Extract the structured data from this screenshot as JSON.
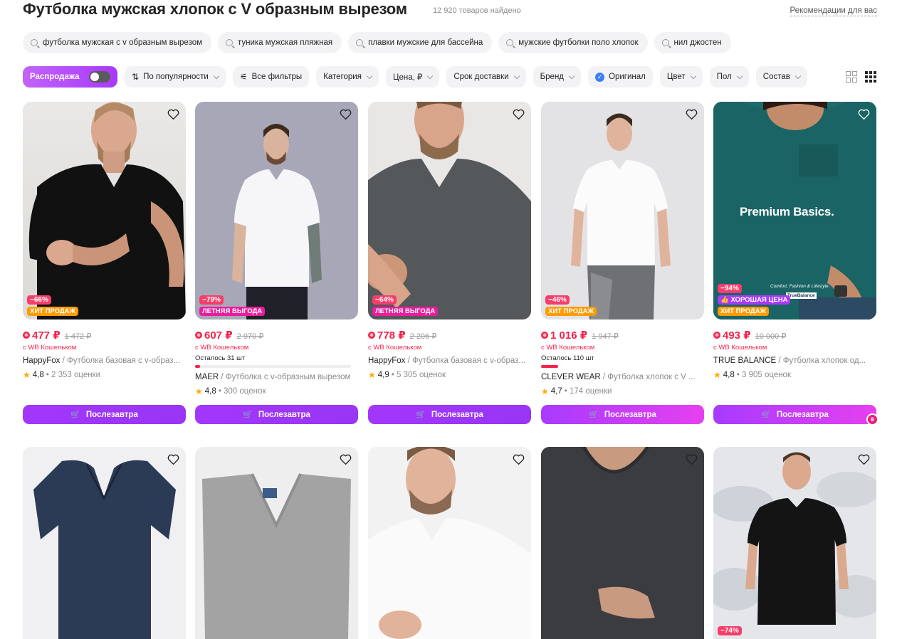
{
  "header": {
    "title": "Футболка мужская хлопок с V образным вырезом",
    "count": "12 920 товаров найдено",
    "recommendations": "Рекомендации для вас"
  },
  "chips": [
    "футболка мужская с v образным вырезом",
    "туника мужская пляжная",
    "плавки мужские для бассейна",
    "мужские футболки поло хлопок",
    "нил джостен"
  ],
  "filters": {
    "sale": "Распродажа",
    "sort": "По популярности",
    "all": "Все фильтры",
    "category": "Категория",
    "price": "Цена, ₽",
    "delivery": "Срок доставки",
    "brand": "Бренд",
    "original": "Оригинал",
    "color": "Цвет",
    "gender": "Пол",
    "composition": "Состав"
  },
  "colors": {
    "accent": "#a73afd",
    "price": "#f3244c",
    "hit": "#ff9b00",
    "summer": "#e91e9d"
  },
  "products": [
    {
      "discount": "−66%",
      "badge": "ХИТ ПРОДАЖ",
      "price": "477 ₽",
      "old": "1 472 ₽",
      "wallet": "с WB Кошельком",
      "brand": "HappyFox",
      "title": " / Футболка базовая с v-образ...",
      "rating": "4,8",
      "reviews": "• 2 353 оценки",
      "button": "Послезавтра"
    },
    {
      "discount": "−79%",
      "badge": "ЛЕТНЯЯ ВЫГОДА",
      "price": "607 ₽",
      "old": "2 970 ₽",
      "wallet": "с WB Кошельком",
      "left": "Осталось 31 шт",
      "left_fraction": 0.03,
      "brand": "MAER",
      "title": " / Футболка с v-образным вырезом",
      "rating": "4,8",
      "reviews": "• 300 оценок",
      "button": "Послезавтра"
    },
    {
      "discount": "−64%",
      "badge": "ЛЕТНЯЯ ВЫГОДА",
      "price": "778 ₽",
      "old": "2 206 ₽",
      "wallet": "с WB Кошельком",
      "brand": "HappyFox",
      "title": " / Футболка базовая с v-образ...",
      "rating": "4,9",
      "reviews": "• 5 305 оценок",
      "button": "Послезавтра"
    },
    {
      "discount": "−46%",
      "badge": "ХИТ ПРОДАЖ",
      "price": "1 016 ₽",
      "old": "1 947 ₽",
      "wallet": "с WB Кошельком",
      "left": "Осталось 110 шт",
      "left_fraction": 0.11,
      "brand": "CLEVER WEAR",
      "title": " / Футболка хлопок с V ...",
      "rating": "4,7",
      "reviews": "• 174 оценки",
      "button": "Послезавтра"
    },
    {
      "discount": "−94%",
      "badge2": "ХОРОШАЯ ЦЕНА",
      "badge": "ХИТ ПРОДАЖ",
      "price": "493 ₽",
      "old": "10 000 ₽",
      "wallet": "с WB Кошельком",
      "brand": "TRUE BALANCE",
      "title": " / Футболка хлопок од...",
      "rating": "4,8",
      "reviews": "• 3 905 оценок",
      "button": "Послезавтра",
      "image_text": "Premium Basics.",
      "image_small": "Comfort, Fashion & Lifestyle.",
      "image_brand": "TrueBalance"
    }
  ],
  "row2_discount": "−74%"
}
